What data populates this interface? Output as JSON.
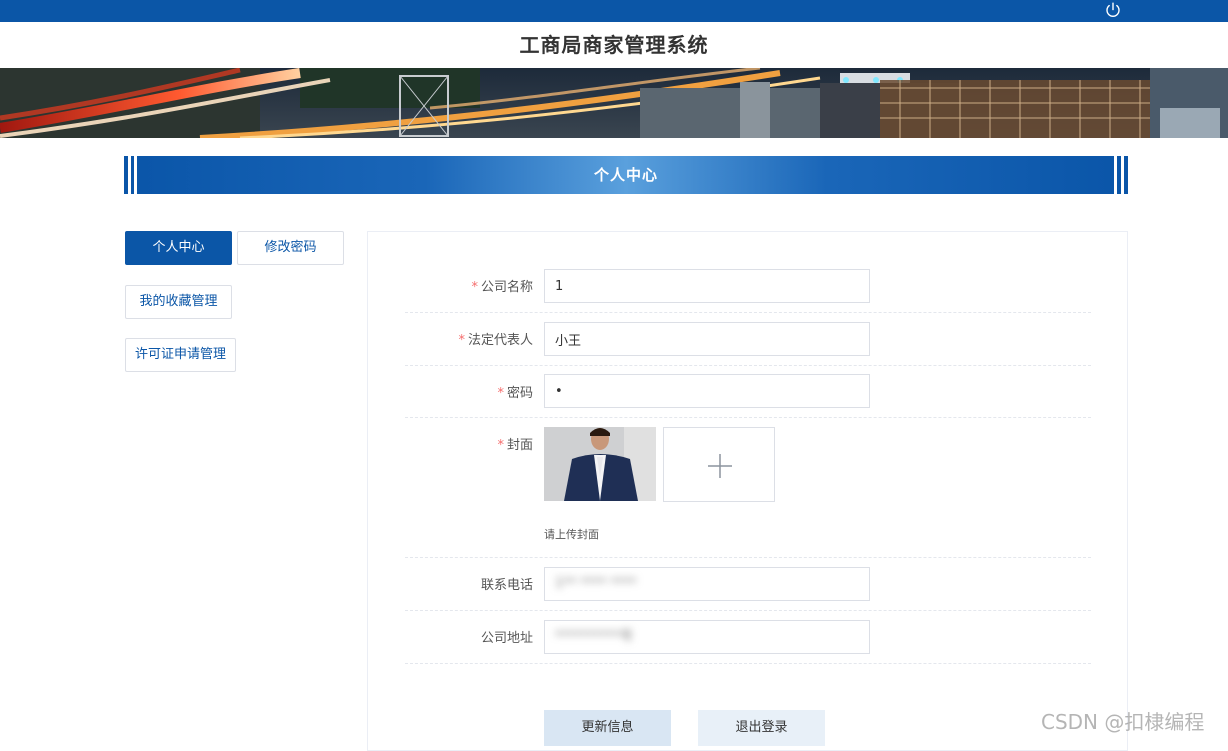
{
  "header": {
    "site_title": "工商局商家管理系统",
    "power_icon": "power-icon",
    "bar_color": "#0b56a7"
  },
  "section": {
    "title": "个人中心"
  },
  "sidebar": {
    "items": [
      {
        "label": "个人中心",
        "active": true
      },
      {
        "label": "修改密码",
        "active": false
      },
      {
        "label": "我的收藏管理",
        "active": false
      },
      {
        "label": "许可证申请管理",
        "active": false
      }
    ]
  },
  "form": {
    "fields": {
      "company_name": {
        "label": "公司名称",
        "required": true,
        "value": "1"
      },
      "legal_rep": {
        "label": "法定代表人",
        "required": true,
        "value": "小王"
      },
      "password": {
        "label": "密码",
        "required": true,
        "value": "•"
      },
      "cover": {
        "label": "封面",
        "required": true,
        "hint": "请上传封面",
        "upload_icon": "plus-icon"
      },
      "phone": {
        "label": "联系电话",
        "required": false,
        "value": "1** **** ****"
      },
      "address": {
        "label": "公司地址",
        "required": false,
        "value": "**********号"
      }
    },
    "required_mark": "*"
  },
  "actions": {
    "update_label": "更新信息",
    "logout_label": "退出登录"
  },
  "watermark": "CSDN @扣棣编程"
}
